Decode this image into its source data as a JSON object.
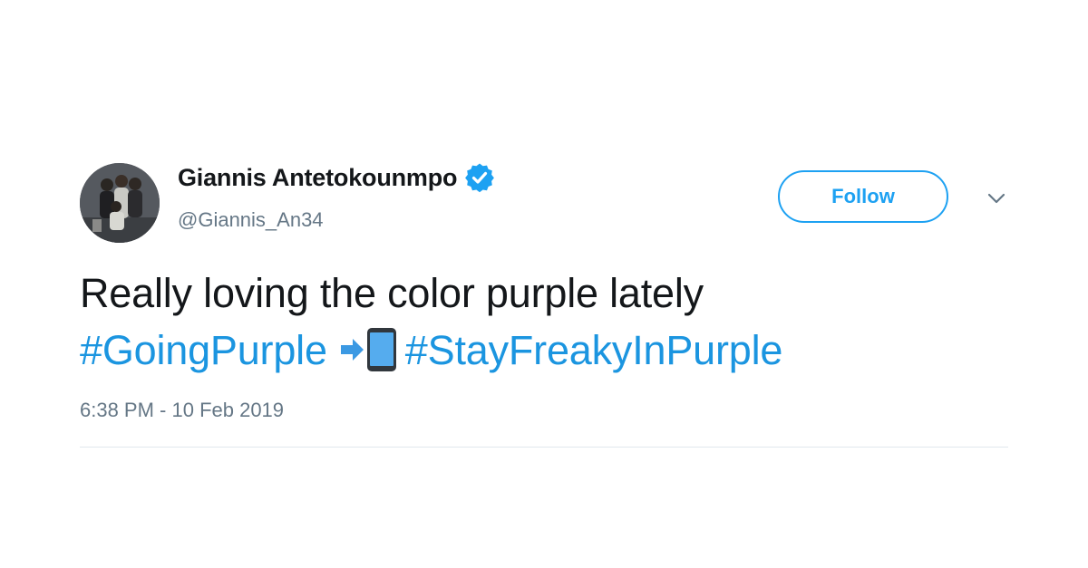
{
  "author": {
    "display_name": "Giannis Antetokounmpo",
    "handle": "@Giannis_An34",
    "verified": true
  },
  "follow_button": {
    "label": "Follow"
  },
  "tweet": {
    "text_line1": "Really loving the color purple lately",
    "hashtag1": "#GoingPurple",
    "emoji": "mobile-phone-with-arrow",
    "hashtag2": "#StayFreakyInPurple",
    "timestamp": "6:38 PM - 10 Feb 2019"
  },
  "colors": {
    "accent": "#1da1f2",
    "hashtag": "#1b95e0",
    "text": "#14171a",
    "secondary_text": "#657786",
    "divider": "#e1e8ed"
  }
}
